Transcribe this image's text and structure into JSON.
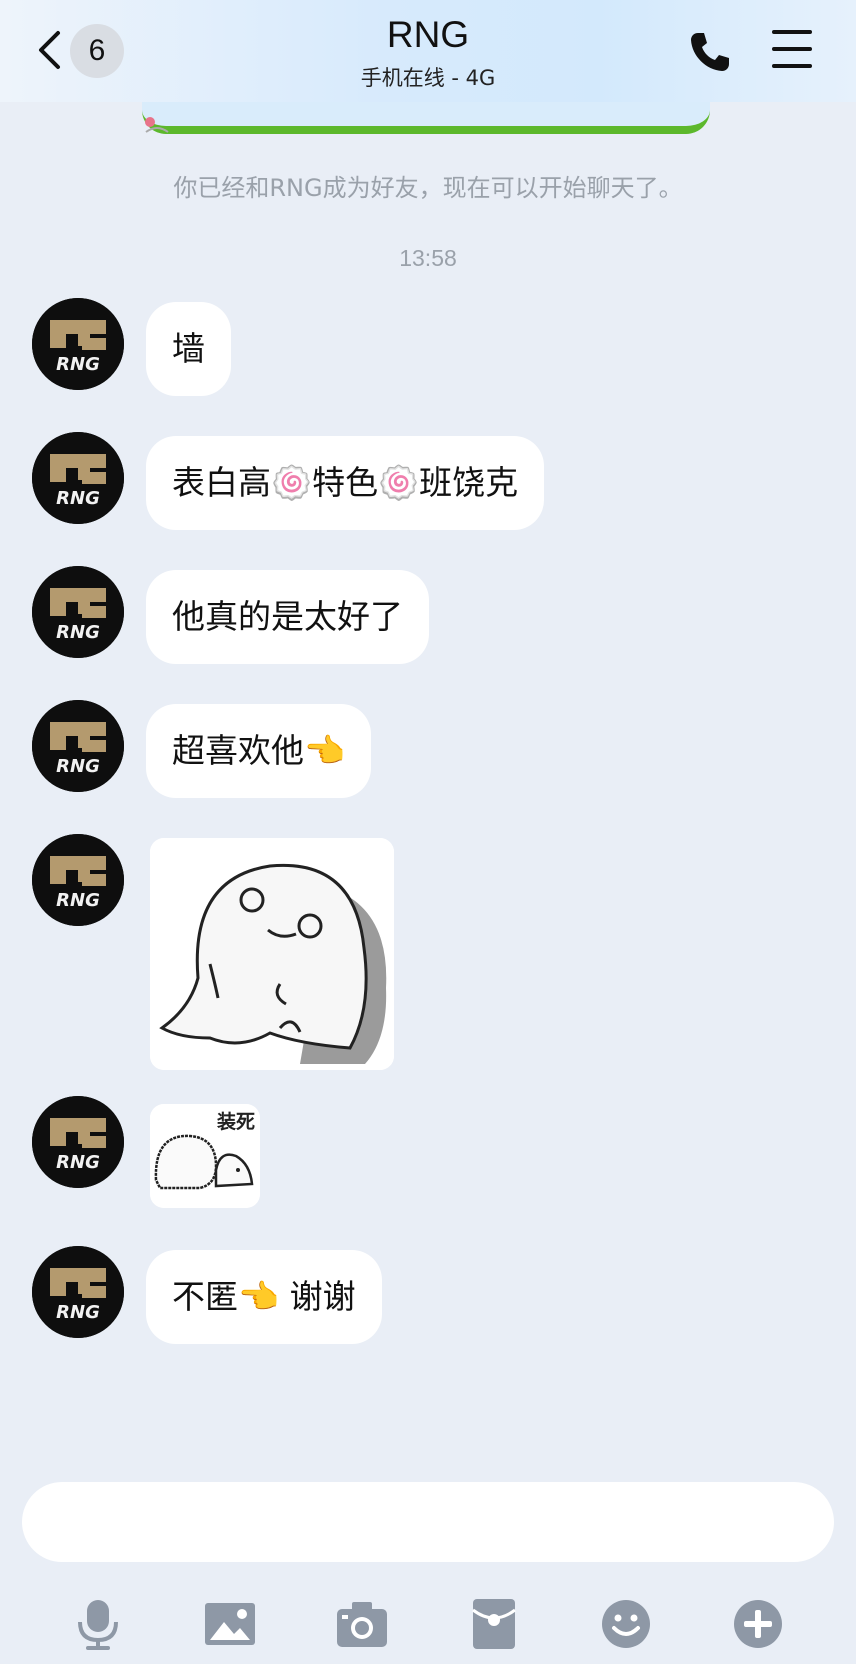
{
  "header": {
    "back_badge": "6",
    "title": "RNG",
    "subtitle": "手机在线 - 4G"
  },
  "system_notice": "你已经和RNG成为好友，现在可以开始聊天了。",
  "timestamp": "13:58",
  "messages": [
    {
      "type": "text",
      "text": "墙"
    },
    {
      "type": "text",
      "text": "表白高🍥特色🍥班饶克"
    },
    {
      "type": "text",
      "text": "他真的是太好了"
    },
    {
      "type": "text",
      "text": "超喜欢他👈"
    },
    {
      "type": "sticker",
      "sticker": "ghost-sticker"
    },
    {
      "type": "sticker",
      "sticker": "playing-dead-sticker",
      "caption": "装死"
    },
    {
      "type": "text",
      "text": "不匿👈 谢谢"
    }
  ],
  "toolbar": [
    "microphone-icon",
    "image-icon",
    "camera-icon",
    "red-packet-icon",
    "emoji-icon",
    "plus-icon"
  ],
  "avatar_logo_text": "RNG",
  "colors": {
    "background": "#e9eef6",
    "bubble": "#ffffff",
    "toolbar_icon": "#8e98a6",
    "banner_green": "#5cb82c"
  }
}
